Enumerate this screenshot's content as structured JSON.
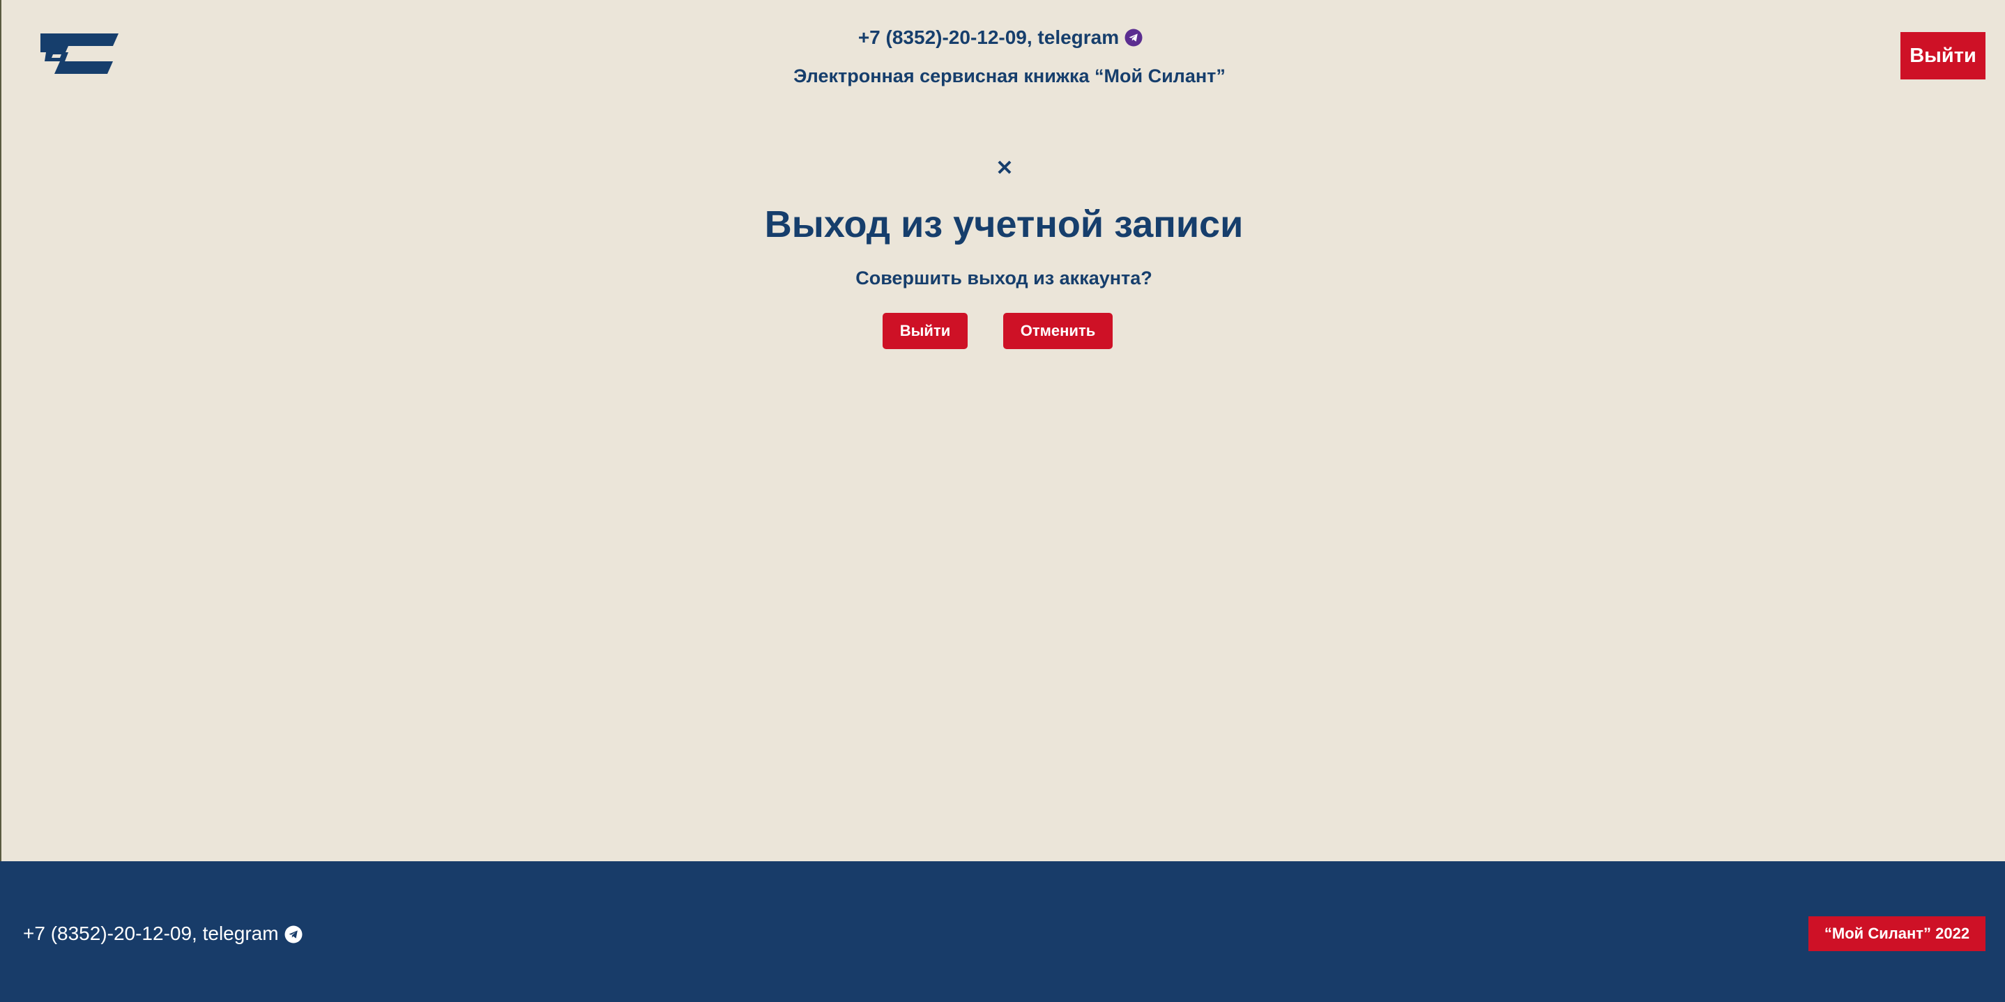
{
  "header": {
    "contact_text": "+7 (8352)-20-12-09, telegram",
    "subtitle": "Электронная сервисная книжка “Мой Силант”",
    "logout_label": "Выйти"
  },
  "modal": {
    "close_glyph": "✕",
    "title": "Выход из учетной записи",
    "question": "Совершить выход из аккаунта?",
    "confirm_label": "Выйти",
    "cancel_label": "Отменить"
  },
  "footer": {
    "contact_text": "+7 (8352)-20-12-09, telegram",
    "copyright": "“Мой Силант” 2022"
  },
  "icons": {
    "logo": "silant-logo-icon",
    "telegram": "telegram-icon",
    "close": "close-icon"
  },
  "colors": {
    "background": "#EBE5D9",
    "primary_blue": "#163E6C",
    "footer_blue": "#183C69",
    "accent_red": "#CE1126",
    "telegram_purple": "#5B2D90"
  }
}
